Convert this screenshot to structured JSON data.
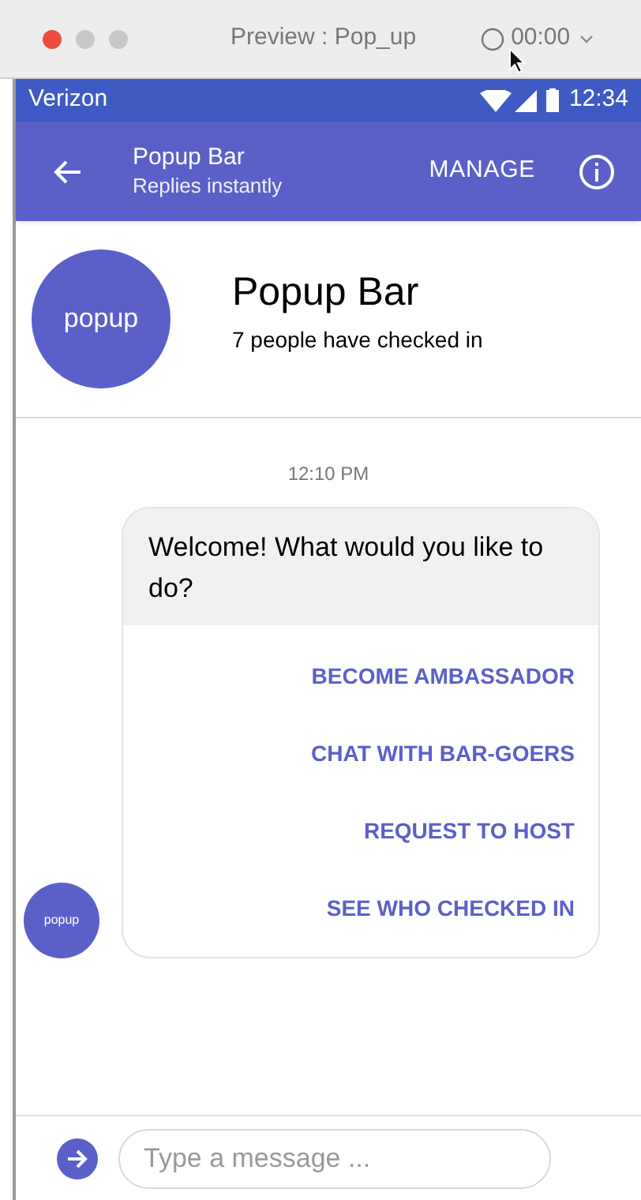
{
  "window": {
    "title": "Preview : Pop_up",
    "timer": "00:00"
  },
  "status_bar": {
    "carrier": "Verizon",
    "time": "12:34"
  },
  "app_bar": {
    "title": "Popup Bar",
    "subtitle": "Replies instantly",
    "action": "MANAGE"
  },
  "profile": {
    "avatar_text": "popup",
    "name": "Popup Bar",
    "checkins": "7 people have checked in"
  },
  "chat": {
    "timestamp": "12:10 PM",
    "avatar_text": "popup",
    "message": "Welcome! What would you like to do?",
    "options": [
      "BECOME AMBASSADOR",
      "CHAT WITH BAR-GOERS",
      "REQUEST TO HOST",
      "SEE WHO CHECKED IN"
    ]
  },
  "composer": {
    "placeholder": "Type a message ..."
  }
}
